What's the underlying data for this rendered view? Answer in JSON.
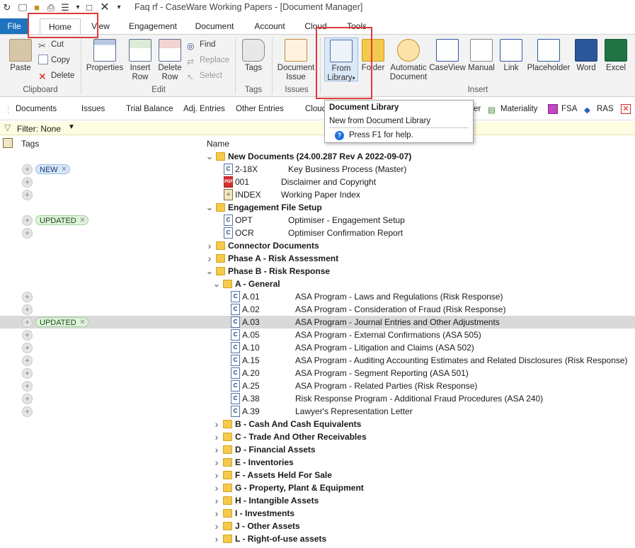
{
  "title_bar": {
    "title": "Faq rf - CaseWare Working Papers - [Document Manager]"
  },
  "tabs": [
    "File",
    "Home",
    "View",
    "Engagement",
    "Document",
    "Account",
    "Cloud",
    "Tools"
  ],
  "ribbon": {
    "clipboard": {
      "paste": "Paste",
      "cut": "Cut",
      "copy": "Copy",
      "delete": "Delete",
      "group": "Clipboard"
    },
    "edit": {
      "properties": "Properties",
      "insert_row_1": "Insert",
      "insert_row_2": "Row",
      "delete_row_1": "Delete",
      "delete_row_2": "Row",
      "find": "Find",
      "replace": "Replace",
      "select": "Select",
      "group": "Edit"
    },
    "tags": {
      "tags": "Tags",
      "group": "Tags"
    },
    "issues": {
      "doc_issue_1": "Document",
      "doc_issue_2": "Issue",
      "group": "Issues"
    },
    "insert": {
      "from_library_1": "From",
      "from_library_2": "Library",
      "folder": "Folder",
      "auto_doc_1": "Automatic",
      "auto_doc_2": "Document",
      "caseview": "CaseView",
      "manual": "Manual",
      "link": "Link",
      "placeholder": "Placeholder",
      "word": "Word",
      "excel": "Excel",
      "group": "Insert"
    }
  },
  "subtoolbar": [
    "Documents",
    "Issues",
    "Trial Balance",
    "Adj. Entries",
    "Other Entries",
    "Cloud",
    "er",
    "Materiality",
    "FSA",
    "RAS"
  ],
  "tooltip": {
    "title": "Document Library",
    "body": "New from Document Library",
    "help": "Press F1 for help."
  },
  "filter": {
    "label": "Filter: None"
  },
  "headers": {
    "tags": "Tags",
    "name": "Name"
  },
  "rows": [
    {
      "kind": "folder",
      "level": 0,
      "open": true,
      "label": "New Documents (24.00.287 Rev A 2022-09-07)"
    },
    {
      "kind": "doc",
      "icon": "cv",
      "level": 1,
      "num": "2-18X",
      "desc": "Key Business Process (Master)",
      "plus": true,
      "badge": "NEW",
      "badge_type": "new"
    },
    {
      "kind": "doc",
      "icon": "pdf",
      "level": 1,
      "num": "001",
      "desc": "Disclaimer and Copyright",
      "plus": true
    },
    {
      "kind": "doc",
      "icon": "idx",
      "level": 1,
      "num": "INDEX",
      "desc": "Working Paper Index",
      "plus": true
    },
    {
      "kind": "folder",
      "level": 0,
      "open": true,
      "label": "Engagement File Setup"
    },
    {
      "kind": "doc",
      "icon": "cv",
      "level": 1,
      "num": "OPT",
      "desc": "Optimiser - Engagement Setup",
      "plus": true,
      "badge": "UPDATED",
      "badge_type": "upd"
    },
    {
      "kind": "doc",
      "icon": "cv",
      "level": 1,
      "num": "OCR",
      "desc": "Optimiser Confirmation Report",
      "plus": true
    },
    {
      "kind": "folder",
      "level": 0,
      "open": false,
      "label": "Connector Documents"
    },
    {
      "kind": "folder",
      "level": 0,
      "open": false,
      "label": "Phase A - Risk Assessment"
    },
    {
      "kind": "folder",
      "level": 0,
      "open": true,
      "label": "Phase B - Risk Response"
    },
    {
      "kind": "folder",
      "level": 1,
      "open": true,
      "label": "A - General"
    },
    {
      "kind": "doc",
      "icon": "cv",
      "level": 2,
      "num": "A.01",
      "desc": "ASA Program - Laws and Regulations (Risk Response)",
      "plus": true
    },
    {
      "kind": "doc",
      "icon": "cv",
      "level": 2,
      "num": "A.02",
      "desc": "ASA Program - Consideration of Fraud (Risk Response)",
      "plus": true
    },
    {
      "kind": "doc",
      "icon": "cv",
      "level": 2,
      "num": "A.03",
      "desc": "ASA Program - Journal Entries and Other Adjustments",
      "plus": true,
      "badge": "UPDATED",
      "badge_type": "upd",
      "selected": true
    },
    {
      "kind": "doc",
      "icon": "cv",
      "level": 2,
      "num": "A.05",
      "desc": "ASA Program - External Confirmations (ASA 505)",
      "plus": true
    },
    {
      "kind": "doc",
      "icon": "cv",
      "level": 2,
      "num": "A.10",
      "desc": "ASA Program - Litigation and Claims (ASA 502)",
      "plus": true
    },
    {
      "kind": "doc",
      "icon": "cv",
      "level": 2,
      "num": "A.15",
      "desc": "ASA Program - Auditing Accounting Estimates and Related Disclosures (Risk Response)",
      "plus": true
    },
    {
      "kind": "doc",
      "icon": "cv",
      "level": 2,
      "num": "A.20",
      "desc": "ASA Program - Segment Reporting (ASA 501)",
      "plus": true
    },
    {
      "kind": "doc",
      "icon": "cv",
      "level": 2,
      "num": "A.25",
      "desc": "ASA Program - Related Parties (Risk Response)",
      "plus": true
    },
    {
      "kind": "doc",
      "icon": "cv",
      "level": 2,
      "num": "A.38",
      "desc": "Risk Response Program - Additional Fraud Procedures (ASA 240)",
      "plus": true
    },
    {
      "kind": "doc",
      "icon": "cv",
      "level": 2,
      "num": "A.39",
      "desc": "Lawyer's Representation Letter",
      "plus": true
    },
    {
      "kind": "folder",
      "level": 1,
      "open": false,
      "label": "B - Cash And Cash Equivalents"
    },
    {
      "kind": "folder",
      "level": 1,
      "open": false,
      "label": "C - Trade And Other Receivables"
    },
    {
      "kind": "folder",
      "level": 1,
      "open": false,
      "label": "D - Financial Assets"
    },
    {
      "kind": "folder",
      "level": 1,
      "open": false,
      "label": "E - Inventories"
    },
    {
      "kind": "folder",
      "level": 1,
      "open": false,
      "label": "F - Assets Held For Sale"
    },
    {
      "kind": "folder",
      "level": 1,
      "open": false,
      "label": "G - Property, Plant & Equipment"
    },
    {
      "kind": "folder",
      "level": 1,
      "open": false,
      "label": "H - Intangible Assets"
    },
    {
      "kind": "folder",
      "level": 1,
      "open": false,
      "label": "I - Investments"
    },
    {
      "kind": "folder",
      "level": 1,
      "open": false,
      "label": "J - Other Assets"
    },
    {
      "kind": "folder",
      "level": 1,
      "open": false,
      "label": "L - Right-of-use assets"
    }
  ]
}
